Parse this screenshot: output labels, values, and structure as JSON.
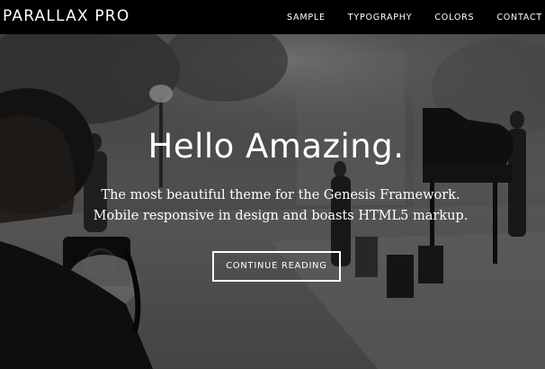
{
  "header": {
    "site_title": "PARALLAX PRO",
    "nav": [
      {
        "label": "SAMPLE"
      },
      {
        "label": "TYPOGRAPHY"
      },
      {
        "label": "COLORS"
      },
      {
        "label": "CONTACT"
      }
    ]
  },
  "hero": {
    "title": "Hello Amazing.",
    "text_line_1": "The most beautiful theme for the Genesis Framework.",
    "text_line_2": "Mobile responsive in design and boasts HTML5 markup.",
    "button_label": "CONTINUE READING"
  },
  "colors": {
    "header_background": "#000000",
    "text": "#ffffff"
  }
}
